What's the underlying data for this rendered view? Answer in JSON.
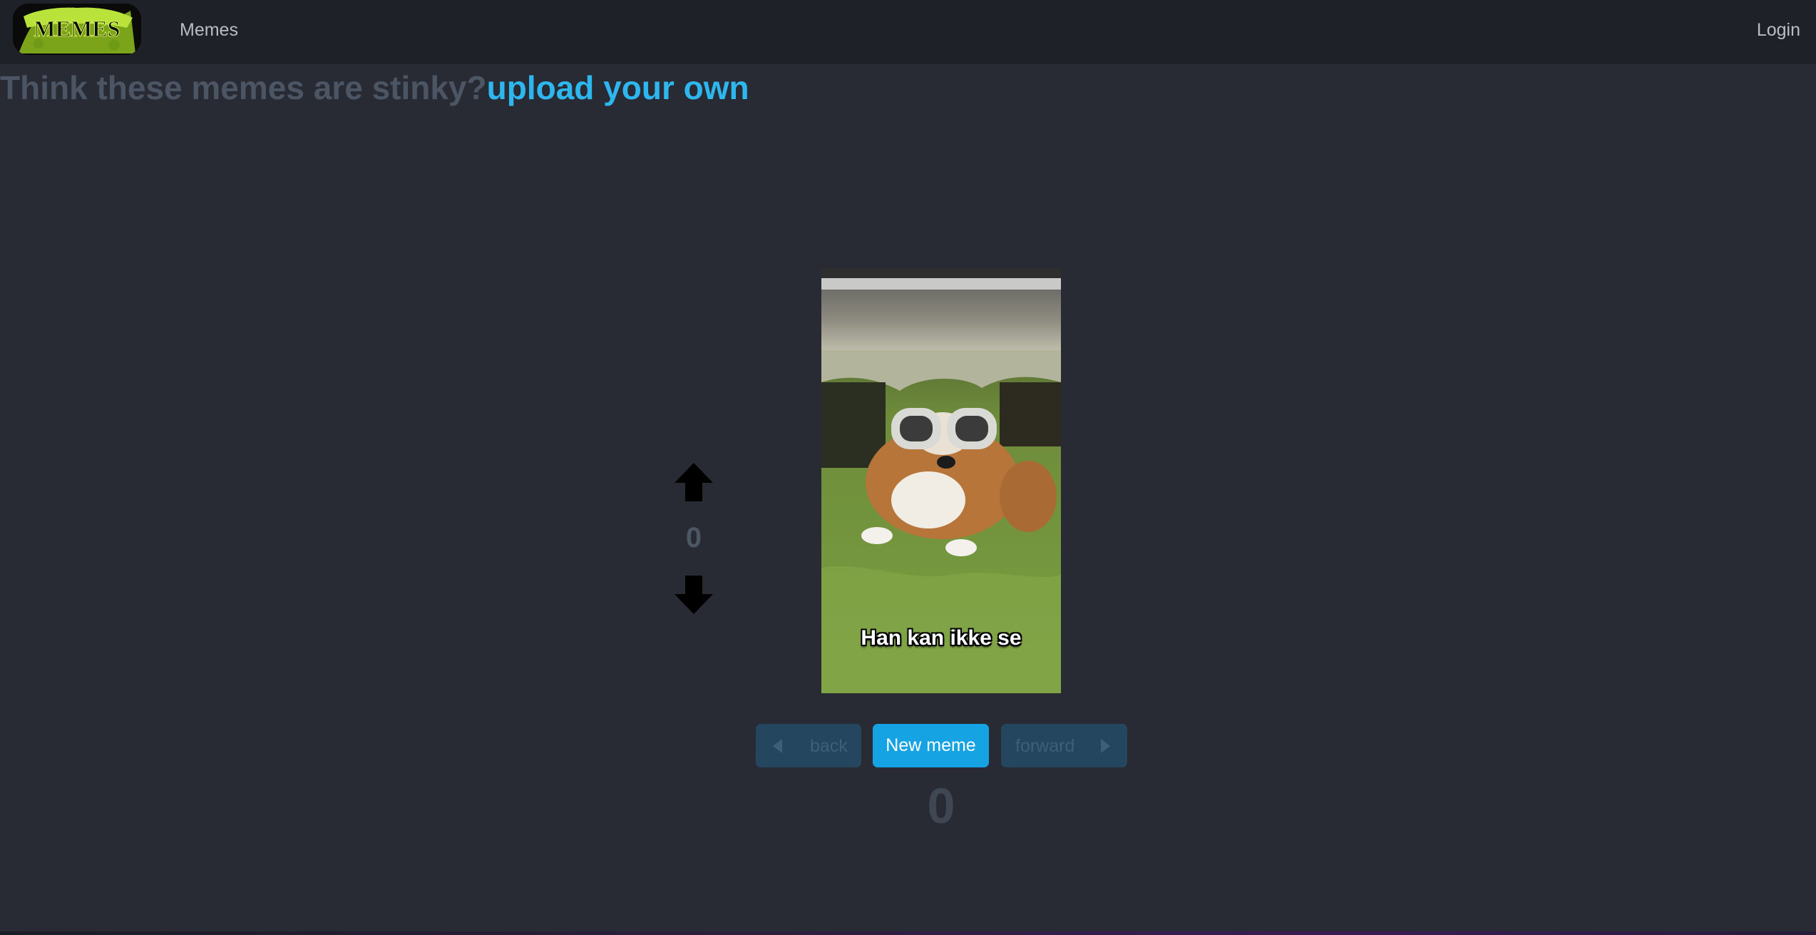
{
  "navbar": {
    "logo_text": "MEMES",
    "memes_link": "Memes",
    "login_link": "Login"
  },
  "headline": {
    "muted_text": "Think these memes are stinky?",
    "link_text": "upload your own"
  },
  "vote": {
    "count": "0",
    "up_icon": "arrow-up-icon",
    "down_icon": "arrow-down-icon"
  },
  "meme": {
    "caption": "Han kan ikke se"
  },
  "controls": {
    "back_label": "back",
    "new_label": "New meme",
    "forward_label": "forward"
  },
  "meme_count": "0",
  "colors": {
    "background": "#282b33",
    "navbar": "#1e2127",
    "accent": "#16a3e3",
    "link": "#2eb6ee"
  }
}
